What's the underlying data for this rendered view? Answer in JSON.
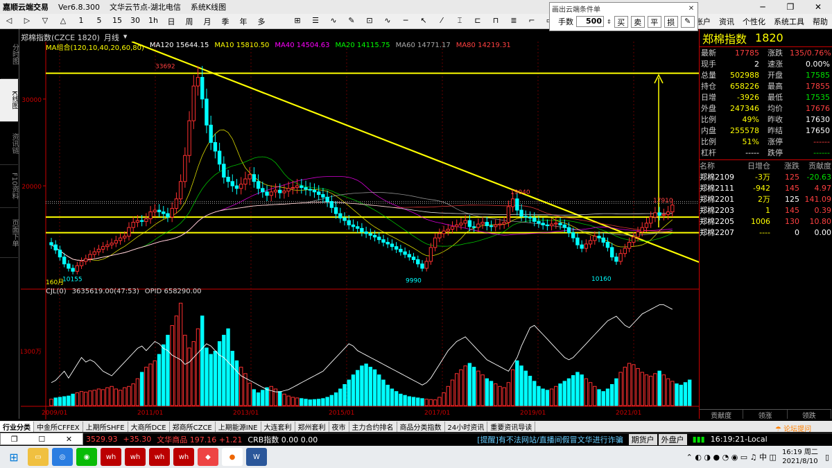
{
  "window": {
    "title": "嘉顺云端交易",
    "version": "Ver6.8.300",
    "node": "文华云节点-湖北电信",
    "mode": "系统K线图"
  },
  "toolbar": {
    "tools": [
      "◁",
      "▷",
      "▽",
      "△",
      "1",
      "5",
      "15",
      "30",
      "1h",
      "日",
      "周",
      "月",
      "季",
      "年",
      "多",
      "",
      "⊞",
      "☰",
      "∿",
      "✎",
      "⊡",
      "∿",
      "─",
      "↖",
      "⁄",
      "⌶",
      "⊏",
      "⊓",
      "≣",
      "⌐",
      "▭"
    ],
    "menu": [
      "账户",
      "资讯",
      "个性化",
      "系统工具",
      "帮助"
    ]
  },
  "dialog": {
    "title": "画出云端条件单",
    "qty_label": "手数",
    "qty": "500",
    "buttons": [
      "买",
      "卖",
      "平",
      "损"
    ]
  },
  "lefttabs": [
    "分时图",
    "K线图",
    "资讯链",
    "F10资料",
    "页面下单"
  ],
  "chartinfo": {
    "symbol": "郑棉指数(CZCE 1820)",
    "period": "月线"
  },
  "ma": {
    "group": "MA组合(120,10,40,20,60,80)",
    "items": [
      {
        "label": "MA120 15644.15",
        "color": "#ffffff"
      },
      {
        "label": "MA10 15810.50",
        "color": "#ffff00"
      },
      {
        "label": "MA40 14504.63",
        "color": "#ff00ff"
      },
      {
        "label": "MA20 14115.75",
        "color": "#00ff00"
      },
      {
        "label": "MA60 14771.17",
        "color": "#aaaaaa"
      },
      {
        "label": "MA80 14219.31",
        "color": "#ff4040"
      }
    ]
  },
  "vol": {
    "name": "CJL(0)",
    "value": "3635619.00(47:53)",
    "opid": "OPID 658290.00"
  },
  "chart_data": {
    "type": "candlestick",
    "title": "郑棉指数",
    "period": "月线",
    "yticks": [
      30000,
      20000
    ],
    "vol_tick": "1300万",
    "xticks": [
      "2009/01",
      "2011/01",
      "2013/01",
      "2015/01",
      "2017/01",
      "2019/01",
      "2021/01"
    ],
    "annotations": {
      "high": "33692",
      "low1": "10155",
      "low2": "9990",
      "low3": "10160",
      "mid": "19040",
      "last": "17910",
      "left_label": "160月"
    },
    "closes": [
      13200,
      12600,
      11800,
      11000,
      10500,
      10155,
      10800,
      11300,
      11600,
      12100,
      12400,
      12700,
      13000,
      13200,
      13400,
      13700,
      14000,
      14200,
      15200,
      15800,
      16000,
      15900,
      16200,
      17000,
      17200,
      17000,
      16800,
      16400,
      17400,
      18500,
      20500,
      23500,
      27500,
      31500,
      32500,
      30000,
      27000,
      25000,
      24000,
      22500,
      21000,
      20500,
      20000,
      19700,
      20200,
      20800,
      21300,
      20500,
      19700,
      19300,
      18900,
      19300,
      19500,
      19200,
      19400,
      19700,
      19800,
      20000,
      19800,
      19600,
      19500,
      19300,
      19000,
      18700,
      18200,
      17500,
      16800,
      16300,
      16000,
      15500,
      15300,
      15100,
      14700,
      14500,
      14300,
      14100,
      13800,
      13500,
      13300,
      13000,
      12700,
      12400,
      12100,
      11800,
      11500,
      11000,
      10500,
      11300,
      12900,
      14000,
      14500,
      14800,
      15000,
      15300,
      15500,
      15700,
      16000,
      15300,
      15200,
      15600,
      15800,
      15400,
      15300,
      15500,
      15600,
      15800,
      17600,
      18500,
      17200,
      16500,
      16400,
      16300,
      15900,
      15700,
      15500,
      15400,
      15600,
      15700,
      15500,
      15200,
      14600,
      14000,
      13200,
      12800,
      13300,
      13700,
      14200,
      14000,
      13500,
      12900,
      11800,
      11300,
      12200,
      12800,
      13500,
      14100,
      14700,
      15200,
      15700,
      16400,
      16900,
      16600,
      16700,
      17000,
      17785
    ],
    "volumes": [
      100,
      120,
      130,
      140,
      150,
      180,
      200,
      220,
      210,
      230,
      240,
      260,
      250,
      280,
      300,
      260,
      240,
      280,
      300,
      340,
      420,
      520,
      600,
      650,
      700,
      800,
      950,
      1100,
      1250,
      1400,
      1600,
      1100,
      900,
      1000,
      1200,
      1400,
      900,
      800,
      850,
      1000,
      1100,
      1200,
      850,
      700,
      600,
      500,
      350,
      250,
      200,
      240,
      280,
      300,
      260,
      220,
      180,
      150,
      130,
      120,
      110,
      100,
      90,
      95,
      100,
      110,
      130,
      160,
      200,
      260,
      330,
      400,
      480,
      550,
      620,
      650,
      600,
      560,
      480,
      400,
      320,
      260,
      220,
      180,
      160,
      140,
      130,
      120,
      110,
      100,
      95,
      90,
      130,
      200,
      300,
      400,
      500,
      560,
      620,
      660,
      600,
      540,
      480,
      420,
      380,
      340,
      300,
      280,
      360,
      560,
      700,
      620,
      540,
      460,
      380,
      300,
      260,
      240,
      260,
      300,
      340,
      380,
      420,
      470,
      520,
      480,
      420,
      360,
      300,
      250,
      220,
      260,
      330,
      420,
      520,
      600,
      660,
      640,
      580,
      520,
      480,
      460,
      500,
      540,
      480,
      420,
      380,
      340,
      320,
      360,
      400
    ],
    "opid_line": [
      200,
      220,
      260,
      300,
      240,
      300,
      360,
      420,
      380,
      400,
      380,
      340,
      300,
      280,
      260,
      300,
      340,
      380,
      420,
      460,
      500,
      520,
      480,
      520,
      560,
      540,
      500,
      480,
      440,
      420,
      400,
      360,
      380,
      420,
      460,
      500,
      540,
      520,
      480,
      440,
      420,
      380,
      340,
      300,
      260,
      240,
      220,
      200,
      180,
      160,
      140,
      130,
      120,
      120,
      130,
      140,
      160,
      180,
      200,
      220,
      240,
      260,
      280,
      300,
      340,
      380,
      420,
      460,
      500,
      540,
      520,
      480,
      460,
      440,
      420,
      400,
      380,
      360,
      340,
      320,
      300,
      280,
      260,
      240,
      220,
      200,
      180,
      200,
      240,
      300,
      360,
      420,
      480,
      520,
      560,
      580,
      600,
      560,
      520,
      480,
      440,
      400,
      380,
      360,
      340,
      320,
      300,
      360,
      420,
      520,
      600,
      680,
      700,
      660,
      620,
      580,
      540,
      500,
      460,
      420,
      400,
      420,
      460,
      500,
      540,
      580,
      620,
      660,
      700,
      740,
      760,
      780,
      740,
      700,
      680,
      720,
      760,
      800,
      820,
      840,
      860,
      880,
      880,
      860,
      840
    ]
  },
  "quote": {
    "name": "郑棉指数",
    "code": "1820",
    "rows": [
      {
        "l1": "最新",
        "v1": "17785",
        "c1": "red",
        "l2": "涨跌",
        "v2": "135/0.76%",
        "c2": "red"
      },
      {
        "l1": "现手",
        "v1": "2",
        "c1": "white",
        "l2": "速涨",
        "v2": "0.00%",
        "c2": "white"
      },
      {
        "l1": "总量",
        "v1": "502988",
        "c1": "yellow",
        "l2": "开盘",
        "v2": "17585",
        "c2": "green"
      },
      {
        "l1": "持仓",
        "v1": "658226",
        "c1": "yellow",
        "l2": "最高",
        "v2": "17855",
        "c2": "red"
      },
      {
        "l1": "日增",
        "v1": "-3926",
        "c1": "yellow",
        "l2": "最低",
        "v2": "17535",
        "c2": "green"
      },
      {
        "l1": "外盘",
        "v1": "247346",
        "c1": "yellow",
        "l2": "均价",
        "v2": "17676",
        "c2": "red"
      },
      {
        "l1": "比例",
        "v1": "49%",
        "c1": "yellow",
        "l2": "昨收",
        "v2": "17630",
        "c2": "white"
      },
      {
        "l1": "内盘",
        "v1": "255578",
        "c1": "yellow",
        "l2": "昨结",
        "v2": "17650",
        "c2": "white"
      },
      {
        "l1": "比例",
        "v1": "51%",
        "c1": "yellow",
        "l2": "涨停",
        "v2": "------",
        "c2": "red"
      },
      {
        "l1": "杠杆",
        "v1": "-----",
        "c1": "white",
        "l2": "跌停",
        "v2": "------",
        "c2": "green"
      }
    ]
  },
  "contracts": {
    "headers": [
      "名称",
      "日增仓",
      "涨跌",
      "贡献度"
    ],
    "rows": [
      {
        "name": "郑棉2109",
        "oi": "-3万",
        "chg": "125",
        "ctb": "-20.63",
        "oic": "yellow",
        "chgc": "red",
        "ctbc": "green"
      },
      {
        "name": "郑棉2111",
        "oi": "-942",
        "chg": "145",
        "ctb": "4.97",
        "oic": "yellow",
        "chgc": "red",
        "ctbc": "red"
      },
      {
        "name": "郑棉2201",
        "oi": "2万",
        "chg": "125",
        "ctb": "141.09",
        "oic": "yellow",
        "chgc": "white",
        "ctbc": "red"
      },
      {
        "name": "郑棉2203",
        "oi": "1",
        "chg": "145",
        "ctb": "0.39",
        "oic": "yellow",
        "chgc": "red",
        "ctbc": "red"
      },
      {
        "name": "郑棉2205",
        "oi": "1006",
        "chg": "130",
        "ctb": "10.80",
        "oic": "yellow",
        "chgc": "red",
        "ctbc": "red"
      },
      {
        "name": "郑棉2207",
        "oi": "----",
        "chg": "0",
        "ctb": "0.00",
        "oic": "yellow",
        "chgc": "white",
        "ctbc": "white"
      }
    ]
  },
  "rtabs": [
    "贡献度",
    "领涨",
    "领跌"
  ],
  "markets": [
    "行业分类",
    "中金所CFFEX",
    "上期所SHFE",
    "大商所DCE",
    "郑商所CZCE",
    "上期能源INE",
    "大连套利",
    "郑州套利",
    "夜市",
    "主力合约排名",
    "商品分类指数",
    "24小时资讯",
    "重要资讯导读"
  ],
  "status": {
    "index": "3529.93",
    "index_chg": "+35.30",
    "commodity": "文华商品 197.16 +1.21",
    "crb": "CRB指数  0.00  0.00",
    "notice": "[提醒]有不法网站/直播间假冒文华进行诈骗",
    "btn1": "期货户",
    "btn2": "外盘户",
    "forum": "论坛提问",
    "time": "16:19:21-Local"
  },
  "taskbar": {
    "time": "16:19 周二",
    "date": "2021/8/10"
  }
}
